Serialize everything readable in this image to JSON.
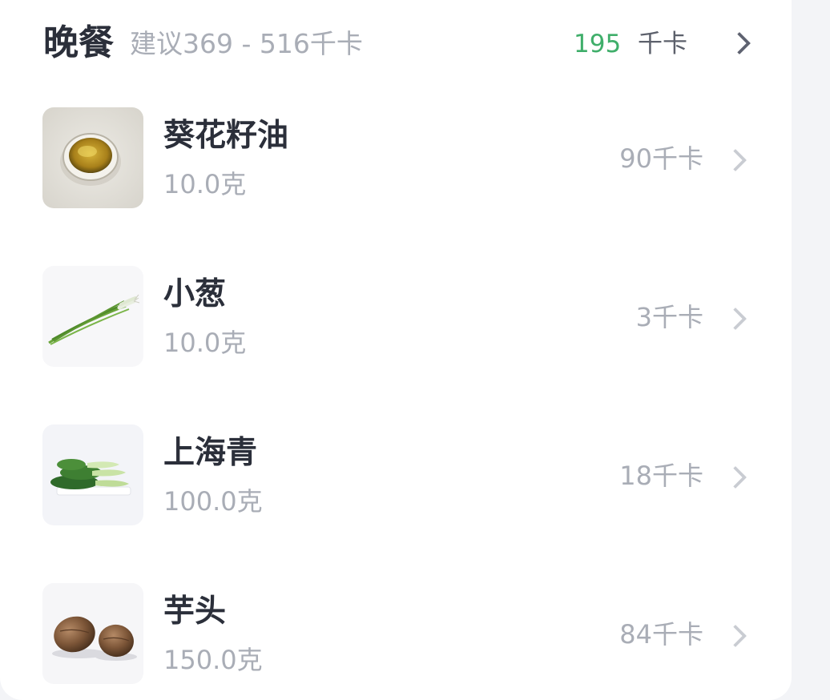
{
  "meal": {
    "title": "晚餐",
    "suggestion": "建议369 - 516千卡",
    "calories": "195",
    "calories_unit": "千卡"
  },
  "items": [
    {
      "name": "葵花籽油",
      "weight": "10.0克",
      "calories": "90千卡",
      "icon": "sunflower-oil-thumbnail"
    },
    {
      "name": "小葱",
      "weight": "10.0克",
      "calories": "3千卡",
      "icon": "scallion-thumbnail"
    },
    {
      "name": "上海青",
      "weight": "100.0克",
      "calories": "18千卡",
      "icon": "bok-choy-thumbnail"
    },
    {
      "name": "芋头",
      "weight": "150.0克",
      "calories": "84千卡",
      "icon": "taro-thumbnail"
    }
  ],
  "colors": {
    "accent_green": "#3fae6a",
    "title_text": "#2b2f3a",
    "muted_text": "#a9adb6",
    "card_bg": "#ffffff",
    "page_bg": "#f3f4f7"
  }
}
